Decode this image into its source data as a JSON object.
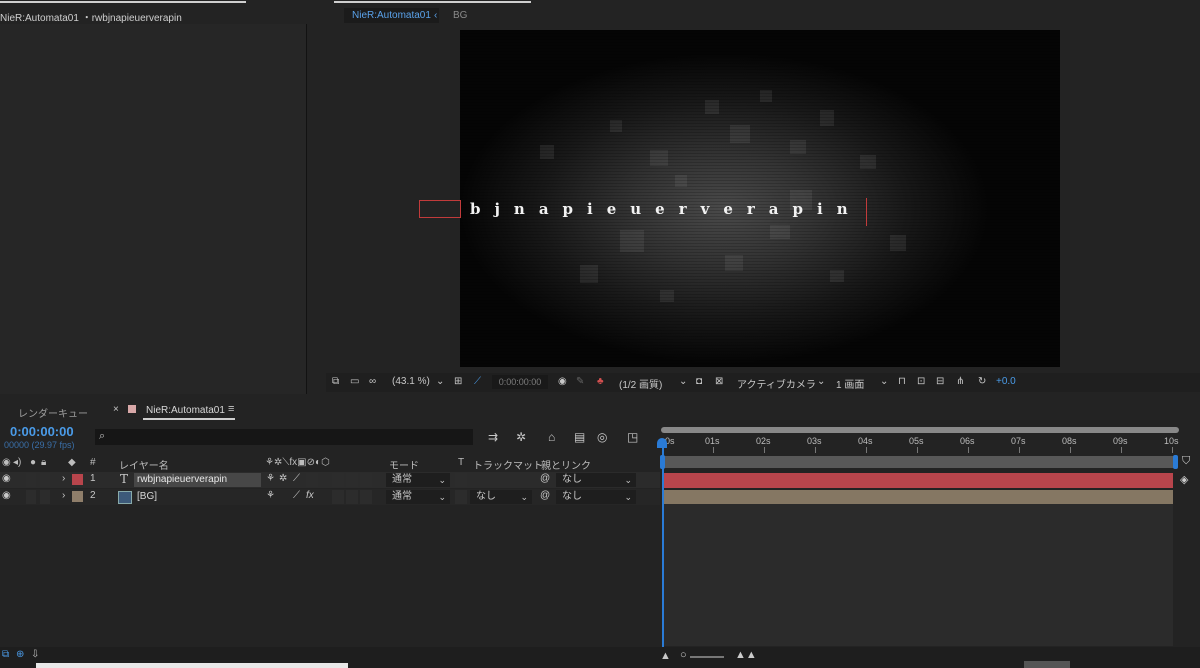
{
  "project_panel": {
    "title": "NieR:Automata01 ・rwbjnapieuerverapin"
  },
  "viewer": {
    "tabs": [
      {
        "label": "NieR:Automata01",
        "active": true
      },
      {
        "label": "BG",
        "active": false
      }
    ],
    "composition_text": "bjnapieuerverapin",
    "toolbar": {
      "zoom": "(43.1 %)",
      "timecode": "0:00:00:00",
      "resolution": "(1/2 画質)",
      "camera": "アクティブカメラ",
      "views": "1 画面",
      "exposure": "+0.0"
    }
  },
  "timeline": {
    "tabs": [
      {
        "label": "レンダーキュー"
      },
      {
        "label": "NieR:Automata01"
      }
    ],
    "current_time": "0:00:00:00",
    "fps_info": "00000 (29.97 fps)",
    "search_placeholder": "",
    "ruler_labels": [
      "0s",
      "01s",
      "02s",
      "03s",
      "04s",
      "05s",
      "06s",
      "07s",
      "08s",
      "09s",
      "10s"
    ],
    "columns": {
      "num": "#",
      "layer_name": "レイヤー名",
      "mode": "モード",
      "t": "T",
      "track_matte": "トラックマット",
      "parent": "親とリンク"
    },
    "layers": [
      {
        "num": "1",
        "type_icon": "T",
        "name": "rwbjnapieuerverapin",
        "mode": "通常",
        "track_matte": "",
        "parent": "なし",
        "label_color": "#b8454c"
      },
      {
        "num": "2",
        "type_icon": "composition-icon",
        "name": "[BG]",
        "mode": "通常",
        "track_matte": "なし",
        "parent": "なし",
        "label_color": "#8f7e6a"
      }
    ]
  }
}
